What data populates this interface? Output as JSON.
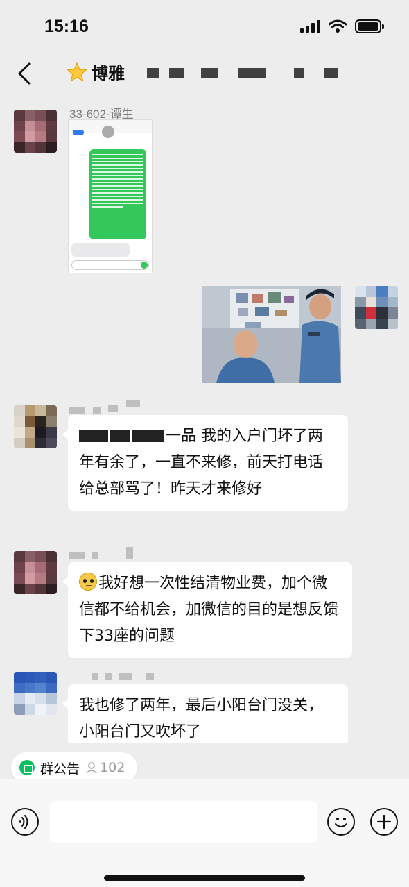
{
  "status_bar": {
    "time": "15:16"
  },
  "nav": {
    "title": "博雅"
  },
  "messages": [
    {
      "sender": "33-602-谭生",
      "type": "image",
      "image_desc": "screenshot-of-sms"
    },
    {
      "from_me": true,
      "type": "image",
      "image_desc": "photo"
    },
    {
      "sender": "",
      "type": "text",
      "text": "一品 我的入户门坏了两年有余了，一直不来修，前天打电话给总部骂了！昨天才来修好"
    },
    {
      "sender": "",
      "type": "text",
      "emoji": "flushed-face",
      "text": "我好想一次性结清物业费，加个微信都不给机会，加微信的目的是想反馈下33座的问题"
    },
    {
      "sender": "",
      "type": "text",
      "text": "我也修了两年，最后小阳台门没关，小阳台门又吹坏了"
    }
  ],
  "group_notice": {
    "label": "群公告",
    "member_count": "102"
  },
  "input": {
    "placeholder": ""
  },
  "colors": {
    "background": "#ededed",
    "accent": "#07c160",
    "bubble": "#ffffff"
  }
}
